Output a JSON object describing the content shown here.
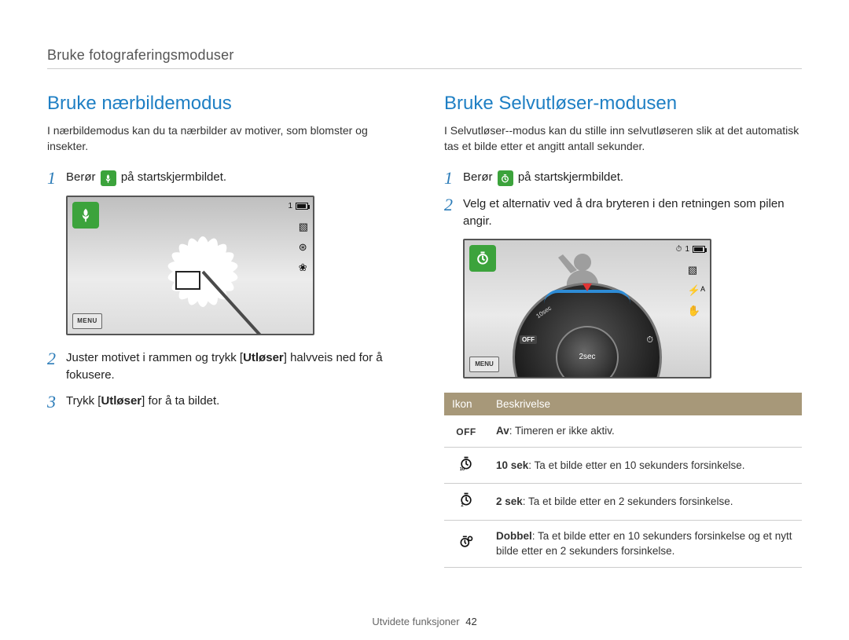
{
  "breadcrumb": "Bruke fotograferingsmoduser",
  "footer": {
    "section": "Utvidete funksjoner",
    "page": "42"
  },
  "left": {
    "title": "Bruke nærbildemodus",
    "intro": "I nærbildemodus kan du ta nærbilder av motiver, som blomster og insekter.",
    "steps": {
      "s1_pre": "Berør ",
      "s1_post": " på startskjermbildet.",
      "s2_pre": "Juster motivet i rammen og trykk [",
      "s2_bold": "Utløser",
      "s2_post": "] halvveis ned for å fokusere.",
      "s3_pre": "Trykk [",
      "s3_bold": "Utløser",
      "s3_post": "] for å ta bildet."
    },
    "screen": {
      "menu": "MENU",
      "count": "1"
    }
  },
  "right": {
    "title": "Bruke Selvutløser-modusen",
    "intro": "I Selvutløser--modus kan du stille inn selvutløseren slik at det automatisk tas et bilde etter et angitt antall sekunder.",
    "steps": {
      "s1_pre": "Berør ",
      "s1_post": " på startskjermbildet.",
      "s2": "Velg et alternativ ved å dra bryteren i den retningen som pilen angir."
    },
    "screen": {
      "menu": "MENU",
      "count": "1",
      "dial_center": "2sec",
      "dial_left": "10sec",
      "dial_off": "OFF"
    },
    "table": {
      "th_icon": "Ikon",
      "th_desc": "Beskrivelse",
      "rows": [
        {
          "icon_text": "OFF",
          "b": "Av",
          "rest": ": Timeren er ikke aktiv."
        },
        {
          "icon_text": "",
          "b": "10 sek",
          "rest": ": Ta et bilde etter en 10 sekunders forsinkelse."
        },
        {
          "icon_text": "",
          "b": "2 sek",
          "rest": ": Ta et bilde etter en 2 sekunders forsinkelse."
        },
        {
          "icon_text": "",
          "b": "Dobbel",
          "rest": ": Ta et bilde etter en 10 sekunders forsinkelse og et nytt bilde etter en 2 sekunders forsinkelse."
        }
      ]
    }
  }
}
